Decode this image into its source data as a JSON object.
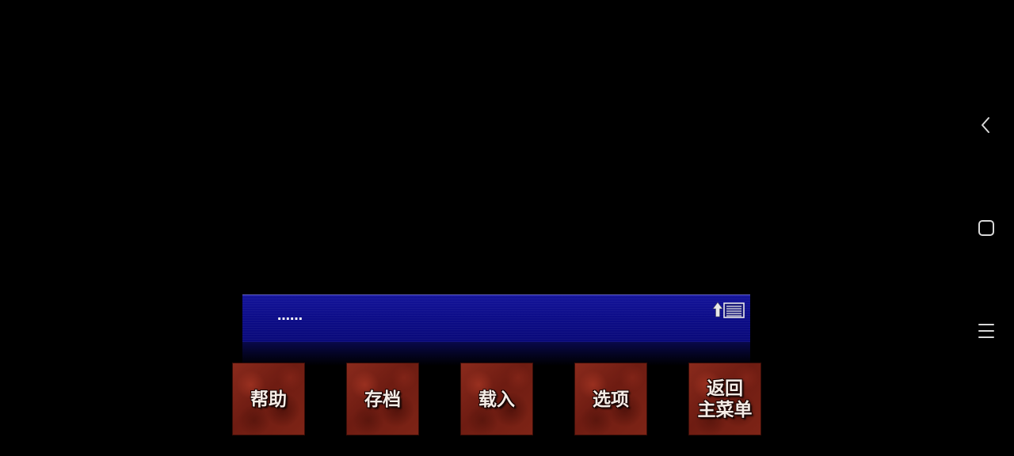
{
  "dialogue": {
    "text": "……",
    "backlog_icon": "backlog-arrow-list-icon"
  },
  "menu": {
    "help_label": "帮助",
    "save_label": "存档",
    "load_label": "载入",
    "options_label": "选项",
    "main_menu_label": "返回\n主菜单"
  },
  "nav": {
    "back_icon": "chevron-left-icon",
    "home_icon": "square-icon",
    "menu_icon": "hamburger-icon"
  },
  "colors": {
    "background": "#000000",
    "dialogue_blue": "#0c0c86",
    "button_red": "#7a2418",
    "text": "#ffffff",
    "nav_icon": "#d8d8d8"
  }
}
